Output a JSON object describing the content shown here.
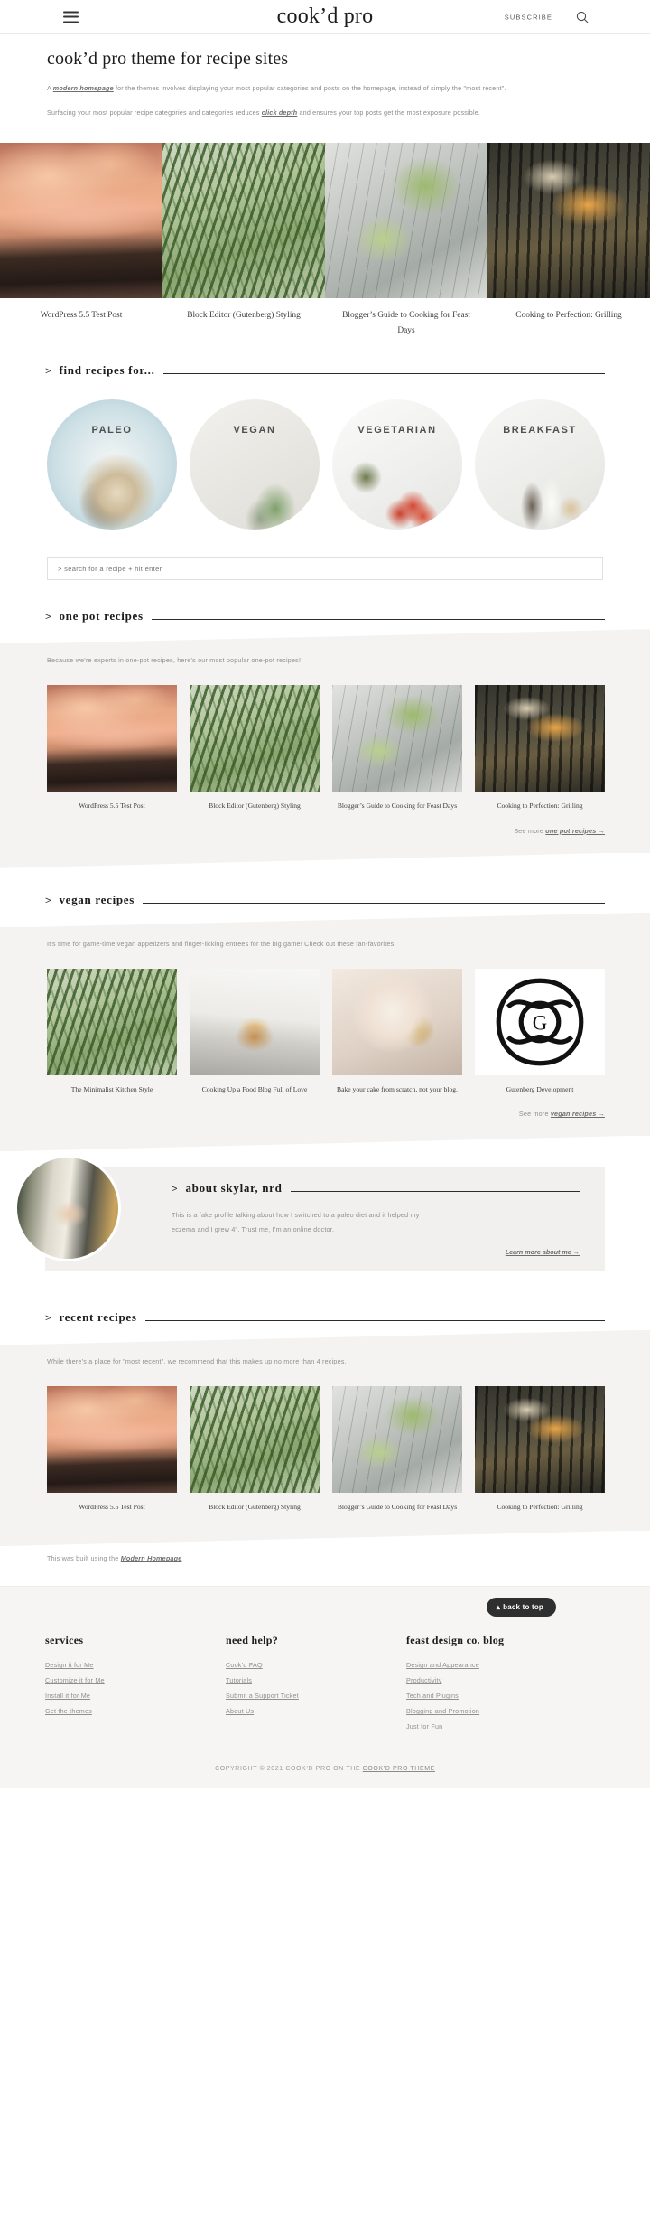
{
  "header": {
    "brand": "cook’d pro",
    "subscribe_label": "SUBSCRIBE",
    "menu_icon": "hamburger-icon",
    "search_icon": "search-icon"
  },
  "intro": {
    "title": "cook’d pro theme for recipe sites",
    "paragraph1_pre": "A ",
    "paragraph1_link": "modern homepage",
    "paragraph1_post": " for the themes involves displaying your most popular categories and posts on the homepage, instead of simply the \"most recent\".",
    "paragraph2_pre": "Surfacing your most popular recipe categories and categories reduces ",
    "paragraph2_link": "click depth",
    "paragraph2_post": " and ensures your top posts get the most exposure possible."
  },
  "featured": [
    {
      "caption": "WordPress 5.5 Test Post",
      "photo": "ph-shrimp"
    },
    {
      "caption": "Block Editor (Gutenberg) Styling",
      "photo": "ph-beans"
    },
    {
      "caption": "Blogger’s Guide to Cooking for Feast Days",
      "photo": "ph-brussels"
    },
    {
      "caption": "Cooking to Perfection: Grilling",
      "photo": "ph-grill"
    }
  ],
  "find_recipes": {
    "chevron": ">",
    "title": "find recipes for...",
    "categories": [
      {
        "label": "PALEO",
        "photo": "ph-paleo"
      },
      {
        "label": "VEGAN",
        "photo": "ph-vegan"
      },
      {
        "label": "VEGETARIAN",
        "photo": "ph-vegetarian"
      },
      {
        "label": "BREAKFAST",
        "photo": "ph-breakfast"
      }
    ]
  },
  "search": {
    "placeholder": "> search for a recipe + hit enter",
    "value": ""
  },
  "one_pot": {
    "chevron": ">",
    "title": "one pot recipes",
    "description": "Because we’re experts in one-pot recipes, here’s our most popular one-pot recipes!",
    "cards": [
      {
        "caption": "WordPress 5.5 Test Post",
        "photo": "ph-shrimp"
      },
      {
        "caption": "Block Editor (Gutenberg) Styling",
        "photo": "ph-beans"
      },
      {
        "caption": "Blogger’s Guide to Cooking for Feast Days",
        "photo": "ph-brussels"
      },
      {
        "caption": "Cooking to Perfection: Grilling",
        "photo": "ph-grill"
      }
    ],
    "seemore_pre": "See more ",
    "seemore_link": "one pot recipes →"
  },
  "vegan": {
    "chevron": ">",
    "title": "vegan recipes",
    "description": "It’s time for game-time vegan appetizers and finger-licking entrees for the big game! Check out these fan-favorites!",
    "cards": [
      {
        "caption": "The Minimalist Kitchen Style",
        "photo": "ph-beans"
      },
      {
        "caption": "Cooking Up a Food Blog Full of Love",
        "photo": "ph-burger"
      },
      {
        "caption": "Bake your cake from scratch, not your blog.",
        "photo": "ph-cake"
      },
      {
        "caption": "Gutenberg Development",
        "photo": "mono",
        "mono_glyph": "G"
      }
    ],
    "seemore_pre": "See more ",
    "seemore_link": "vegan recipes →"
  },
  "about": {
    "chevron": ">",
    "title": "about skylar, nrd",
    "text": "This is a fake profile talking about how I switched to a paleo diet and it helped my eczema and I grew 4\". Trust me, I’m an online doctor.",
    "link": "Learn more about me →",
    "avatar_photo": "ph-skylar",
    "avatar_name": "avatar"
  },
  "recent": {
    "chevron": ">",
    "title": "recent recipes",
    "description": "While there’s a place for \"most recent\", we recommend that this makes up no more than 4 recipes.",
    "cards": [
      {
        "caption": "WordPress 5.5 Test Post",
        "photo": "ph-shrimp"
      },
      {
        "caption": "Block Editor (Gutenberg) Styling",
        "photo": "ph-beans"
      },
      {
        "caption": "Blogger’s Guide to Cooking for Feast Days",
        "photo": "ph-brussels"
      },
      {
        "caption": "Cooking to Perfection: Grilling",
        "photo": "ph-grill"
      }
    ]
  },
  "builtwith": {
    "pre": "This was built using the ",
    "link": "Modern Homepage"
  },
  "footer": {
    "back_to_top": "back to top",
    "back_to_top_icon": "arrow-up-icon",
    "columns": [
      {
        "heading": "services",
        "links": [
          "Design it for Me",
          "Customize it for Me",
          "Install it for Me",
          "Get the themes"
        ]
      },
      {
        "heading": "need help?",
        "links": [
          "Cook’d FAQ",
          "Tutorials",
          "Submit a Support Ticket",
          "About Us"
        ]
      },
      {
        "heading": "feast design co. blog",
        "links": [
          "Design and Appearance",
          "Productivity",
          "Tech and Plugins",
          "Blogging and Promotion",
          "Just for Fun"
        ]
      }
    ],
    "copyright_pre": "COPYRIGHT © 2021 COOK’D PRO ON THE ",
    "copyright_link": "COOK’D PRO THEME"
  },
  "colors": {
    "accent_dark": "#2f2f2f",
    "band_grey": "#f4f3f1",
    "footer_grey": "#f6f5f3",
    "text_muted": "#8f8f91"
  }
}
